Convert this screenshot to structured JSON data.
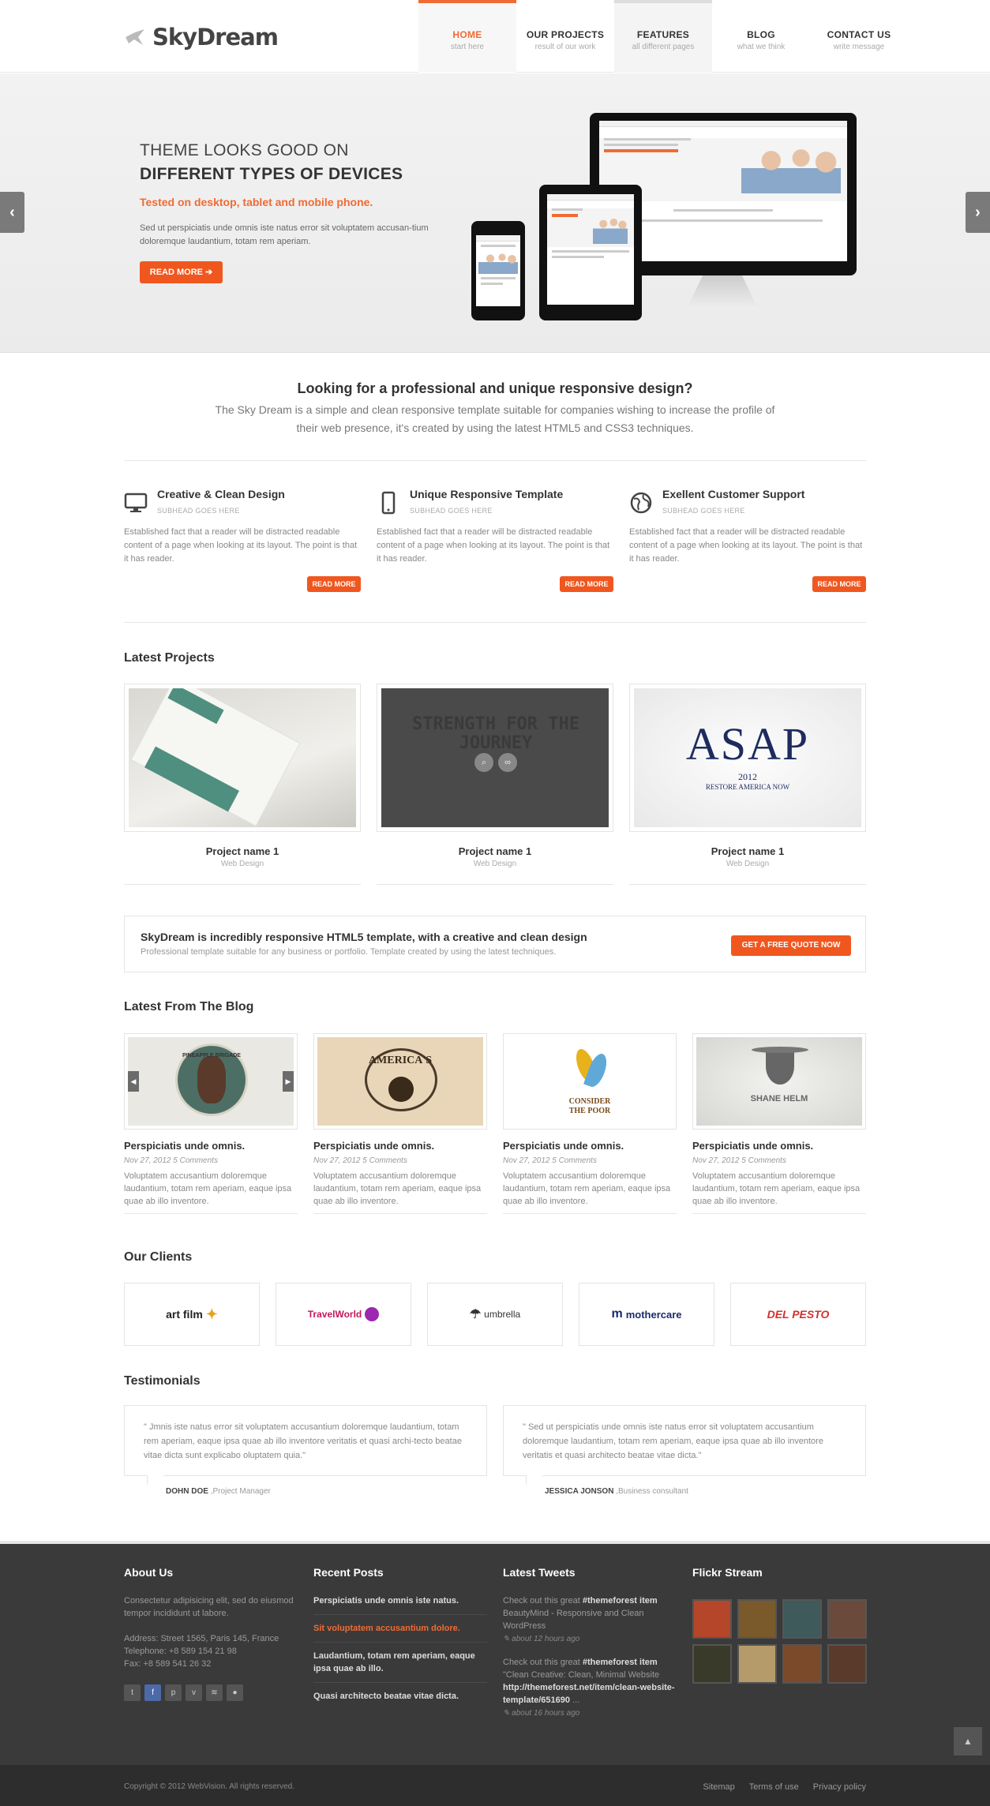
{
  "brand": {
    "name": "SkyDream",
    "accent": "#f06b34"
  },
  "nav": [
    {
      "label": "HOME",
      "sub": "start here"
    },
    {
      "label": "OUR PROJECTS",
      "sub": "result of our work"
    },
    {
      "label": "FEATURES",
      "sub": "all different pages"
    },
    {
      "label": "BLOG",
      "sub": "what we think"
    },
    {
      "label": "CONTACT US",
      "sub": "write message"
    }
  ],
  "hero": {
    "title_line1": "THEME LOOKS GOOD ON",
    "title_line2": "DIFFERENT TYPES OF DEVICES",
    "subtitle": "Tested on desktop, tablet and mobile phone.",
    "text": "Sed ut perspiciatis unde omnis iste natus error sit voluptatem accusan-tium doloremque laudantium, totam rem aperiam.",
    "button": "READ MORE ➔",
    "prev_icon": "‹",
    "next_icon": "›"
  },
  "intro": {
    "title": "Looking for a professional and unique responsive design?",
    "text": "The Sky Dream is a simple and clean responsive template suitable for companies wishing to increase the profile of their web presence, it's created by using the latest HTML5 and CSS3 techniques."
  },
  "features": [
    {
      "icon": "monitor-icon",
      "title": "Creative & Clean Design",
      "sub": "SUBHEAD GOES HERE",
      "text": "Established fact that a reader will be distracted readable content of a page when looking at its layout. The point is that it has reader.",
      "button": "READ MORE"
    },
    {
      "icon": "phone-icon",
      "title": "Unique Responsive Template",
      "sub": "SUBHEAD GOES HERE",
      "text": "Established fact that a reader will be distracted readable content of a page when looking at its layout. The point is that it has reader.",
      "button": "READ MORE"
    },
    {
      "icon": "globe-icon",
      "title": "Exellent Customer Support",
      "sub": "SUBHEAD GOES HERE",
      "text": "Established fact that a reader will be distracted readable content of a page when looking at its layout. The point is that it has reader.",
      "button": "READ MORE"
    }
  ],
  "projects": {
    "title": "Latest Projects",
    "items": [
      {
        "name": "Project name 1",
        "category": "Web Design"
      },
      {
        "name": "Project name 1",
        "category": "Web Design",
        "overlay_text": "STRENGTH FOR THE JOURNEY"
      },
      {
        "name": "Project name 1",
        "category": "Web Design",
        "logo_text": "ASAP",
        "logo_year": "2012",
        "logo_caption": "RESTORE AMERICA NOW"
      }
    ]
  },
  "cta": {
    "title": "SkyDream is incredibly responsive HTML5 template, with a creative and clean design",
    "text": "Professional template suitable for any business or portfolio. Template created by using the latest techniques.",
    "button": "GET A FREE QUOTE NOW"
  },
  "blog": {
    "title": "Latest From The Blog",
    "items": [
      {
        "title": "Perspiciatis unde omnis.",
        "meta": "Nov 27, 2012 5 Comments",
        "text": "Voluptatem accusantium doloremque laudantium, totam rem aperiam, eaque ipsa quae ab illo inventore.",
        "img_label": "PINEAPPLE BRIGADE"
      },
      {
        "title": "Perspiciatis unde omnis.",
        "meta": "Nov 27, 2012 5 Comments",
        "text": "Voluptatem accusantium doloremque laudantium, totam rem aperiam, eaque ipsa quae ab illo inventore.",
        "img_label": "AMERICA'S"
      },
      {
        "title": "Perspiciatis unde omnis.",
        "meta": "Nov 27, 2012 5 Comments",
        "text": "Voluptatem accusantium doloremque laudantium, totam rem aperiam, eaque ipsa quae ab illo inventore.",
        "img_label": "CONSIDER THE POOR"
      },
      {
        "title": "Perspiciatis unde omnis.",
        "meta": "Nov 27, 2012 5 Comments",
        "text": "Voluptatem accusantium doloremque laudantium, totam rem aperiam, eaque ipsa quae ab illo inventore.",
        "img_label": "SHANE HELM"
      }
    ]
  },
  "clients": {
    "title": "Our Clients",
    "items": [
      {
        "name": "art film",
        "color": "#222"
      },
      {
        "name": "TravelWorld",
        "color": "#c2185b"
      },
      {
        "name": "umbrella",
        "color": "#333"
      },
      {
        "name": "mothercare",
        "color": "#1b2b6b"
      },
      {
        "name": "DEL PESTO",
        "color": "#d32f2f"
      }
    ]
  },
  "testimonials": {
    "title": "Testimonials",
    "items": [
      {
        "quote": "\" Jmnis iste natus error sit voluptatem accusantium doloremque laudantium, totam rem aperiam, eaque ipsa quae ab illo inventore veritatis et quasi archi-tecto beatae vitae dicta sunt explicabo oluptatem quia.\"",
        "author": "DOHN DOE",
        "role": ",Project Manager"
      },
      {
        "quote": "\" Sed ut perspiciatis unde omnis iste natus error sit voluptatem accusantium doloremque laudantium, totam rem aperiam, eaque ipsa quae ab illo inventore veritatis et quasi architecto beatae vitae dicta.\"",
        "author": "JESSICA JONSON",
        "role": ",Business consultant"
      }
    ]
  },
  "footer": {
    "about": {
      "title": "About Us",
      "text": "Consectetur adipisicing elit, sed do eiusmod tempor incididunt ut labore.",
      "address": "Address: Street 1565, Paris 145, France",
      "phone": "Telephone: +8 589 154 21 98",
      "fax": "Fax: +8 589 541 26 32"
    },
    "recent_posts": {
      "title": "Recent Posts",
      "items": [
        "Perspiciatis unde omnis iste natus.",
        "Sit voluptatem accusantium dolore.",
        "Laudantium, totam rem aperiam, eaque ipsa quae ab illo.",
        "Quasi architecto beatae vitae dicta."
      ]
    },
    "tweets": {
      "title": "Latest Tweets",
      "items": [
        {
          "prefix": "Check out this great ",
          "tag": "#themeforest item",
          "body": " BeautyMind - Responsive and Clean WordPress",
          "time": "about 12 hours ago"
        },
        {
          "prefix": "Check out this great ",
          "tag": "#themeforest item",
          "body": " \"Clean Creative: Clean, Minimal Website",
          "link": "http://themeforest.net/item/clean-website-template/651690",
          "suffix": " ...",
          "time": "about 16 hours ago"
        }
      ]
    },
    "flickr": {
      "title": "Flickr Stream"
    },
    "copyright": "Copyright © 2012 WebVision. All rights reserved.",
    "links": [
      "Sitemap",
      "Terms of use",
      "Privacy policy"
    ]
  }
}
